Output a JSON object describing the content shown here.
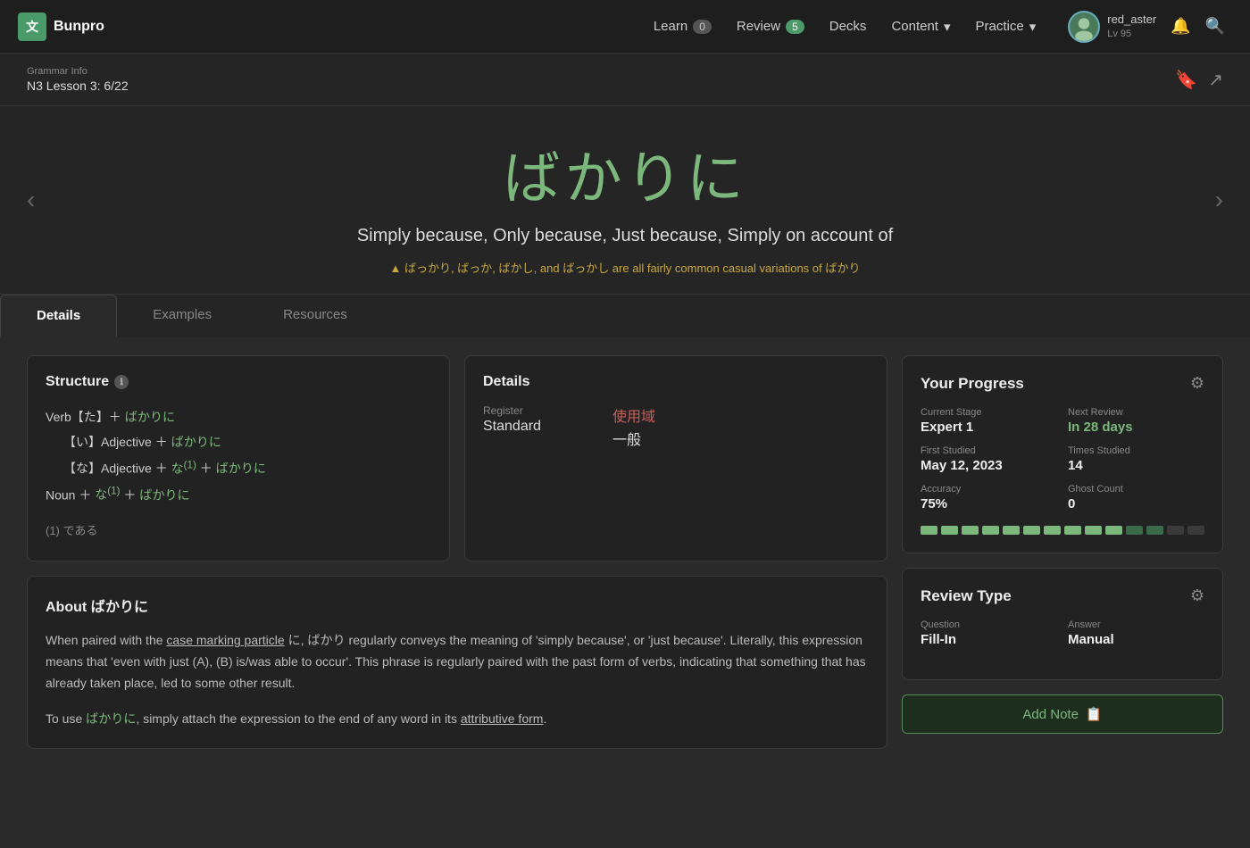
{
  "app": {
    "logo_text": "Bunpro",
    "logo_icon": "文"
  },
  "navbar": {
    "items": [
      {
        "id": "learn",
        "label": "Learn",
        "badge": "0",
        "badge_type": "normal"
      },
      {
        "id": "review",
        "label": "Review",
        "badge": "5",
        "badge_type": "green"
      },
      {
        "id": "decks",
        "label": "Decks",
        "badge": null
      },
      {
        "id": "content",
        "label": "Content",
        "badge": null,
        "has_dropdown": true
      },
      {
        "id": "practice",
        "label": "Practice",
        "badge": null,
        "has_dropdown": true
      }
    ],
    "user": {
      "name": "red_aster",
      "level": "Lv 95"
    },
    "icons": {
      "bell": "🔔",
      "search": "🔍"
    }
  },
  "breadcrumb": {
    "top": "Grammar Info",
    "main": "N3 Lesson 3: 6/22"
  },
  "grammar": {
    "title": "ばかりに",
    "subtitle": "Simply because, Only because, Just because, Simply on account of",
    "note": "▲ ばっかり, ばっか, ばかし, and ばっかし are all fairly common casual variations of ばかり"
  },
  "tabs": [
    {
      "id": "details",
      "label": "Details",
      "active": true
    },
    {
      "id": "examples",
      "label": "Examples",
      "active": false
    },
    {
      "id": "resources",
      "label": "Resources",
      "active": false
    }
  ],
  "structure": {
    "title": "Structure",
    "lines": [
      {
        "prefix": "Verb【た】＋",
        "term": "ばかりに",
        "indent": 0
      },
      {
        "prefix": "【い】Adjective ＋",
        "term": "ばかりに",
        "indent": 1
      },
      {
        "prefix": "【な】Adjective ＋ な",
        "sup": "(1)",
        "term": "＋ ばかりに",
        "indent": 1
      },
      {
        "prefix": "Noun ＋ な",
        "sup": "(1)",
        "term": "＋ ばかりに",
        "indent": 0
      }
    ],
    "footnote": "(1) である"
  },
  "details_card": {
    "title": "Details",
    "register_label": "Register",
    "register_value": "Standard",
    "usage_label": "使用域",
    "usage_value": "一般"
  },
  "about": {
    "title": "About ばかりに",
    "paragraphs": [
      "When paired with the case marking particle に, ばかり regularly conveys the meaning of 'simply because', or 'just because'. Literally, this expression means that 'even with just (A), (B) is/was able to occur'. This phrase is regularly paired with the past form of verbs, indicating that something that has already taken place, led to some other result.",
      "To use ばかりに, simply attach the expression to the end of any word in its attributive form."
    ]
  },
  "progress": {
    "title": "Your Progress",
    "stats": [
      {
        "label": "Current Stage",
        "value": "Expert 1",
        "green": false
      },
      {
        "label": "Next Review",
        "value": "In 28 days",
        "green": true
      },
      {
        "label": "First Studied",
        "value": "May 12, 2023",
        "green": false
      },
      {
        "label": "Times Studied",
        "value": "14",
        "green": false
      },
      {
        "label": "Accuracy",
        "value": "75%",
        "green": false
      },
      {
        "label": "Ghost Count",
        "value": "0",
        "green": false
      }
    ],
    "bars": [
      "filled",
      "filled",
      "filled",
      "filled",
      "filled",
      "filled",
      "filled",
      "filled",
      "filled",
      "filled",
      "light",
      "light",
      "empty",
      "empty"
    ]
  },
  "review_type": {
    "title": "Review Type",
    "question_label": "Question",
    "question_value": "Fill-In",
    "answer_label": "Answer",
    "answer_value": "Manual"
  },
  "add_note": {
    "label": "Add Note"
  },
  "colors": {
    "green": "#7cb87c",
    "accent_dark": "#4a9a6a"
  }
}
